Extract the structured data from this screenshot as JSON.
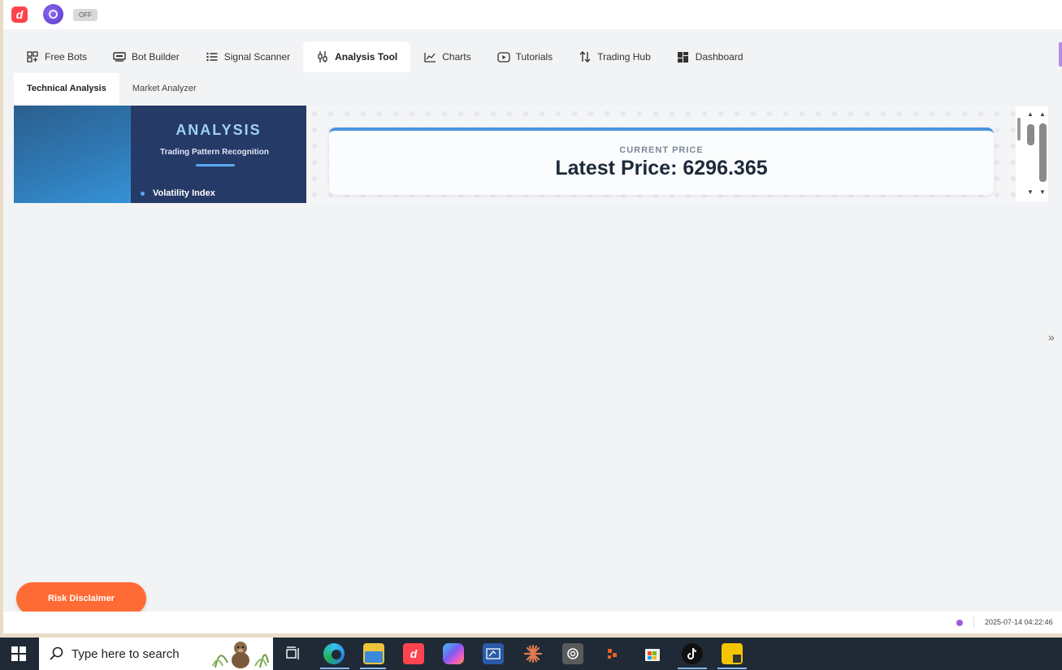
{
  "topbar": {
    "logo_letter": "d",
    "toggle_label": "OFF"
  },
  "main_tabs": [
    {
      "label": "Free Bots",
      "icon": "grid-plus-icon"
    },
    {
      "label": "Bot Builder",
      "icon": "bot-builder-icon"
    },
    {
      "label": "Signal Scanner",
      "icon": "list-icon"
    },
    {
      "label": "Analysis Tool",
      "icon": "sliders-icon",
      "active": true
    },
    {
      "label": "Charts",
      "icon": "line-chart-icon"
    },
    {
      "label": "Tutorials",
      "icon": "play-icon"
    },
    {
      "label": "Trading Hub",
      "icon": "arrows-updown-icon"
    },
    {
      "label": "Dashboard",
      "icon": "dashboard-icon"
    }
  ],
  "sub_tabs": [
    {
      "label": "Technical Analysis",
      "active": true
    },
    {
      "label": "Market Analyzer"
    }
  ],
  "banner": {
    "title": "ANALYSIS",
    "subtitle": "Trading Pattern Recognition",
    "item": "Volatility Index"
  },
  "price_card": {
    "label": "CURRENT PRICE",
    "value": "Latest Price: 6296.365"
  },
  "risk_button": "Risk Disclaimer",
  "footer": {
    "timestamp": "2025-07-14 04:22:46",
    "status_color": "#a05cdc"
  },
  "taskbar": {
    "search_placeholder": "Type here to search",
    "apps": [
      "task-view-icon",
      "edge-icon",
      "file-explorer-icon",
      "deriv-app-icon",
      "copilot-icon",
      "whiteboard-icon",
      "claude-icon",
      "chatgpt-icon",
      "office-icon",
      "store-icon",
      "tiktok-icon",
      "sticky-notes-icon"
    ]
  },
  "colors": {
    "accent": "#ff444f",
    "risk": "#ff6b35",
    "banner": "#253a66",
    "price_border": "#4a93e0"
  }
}
